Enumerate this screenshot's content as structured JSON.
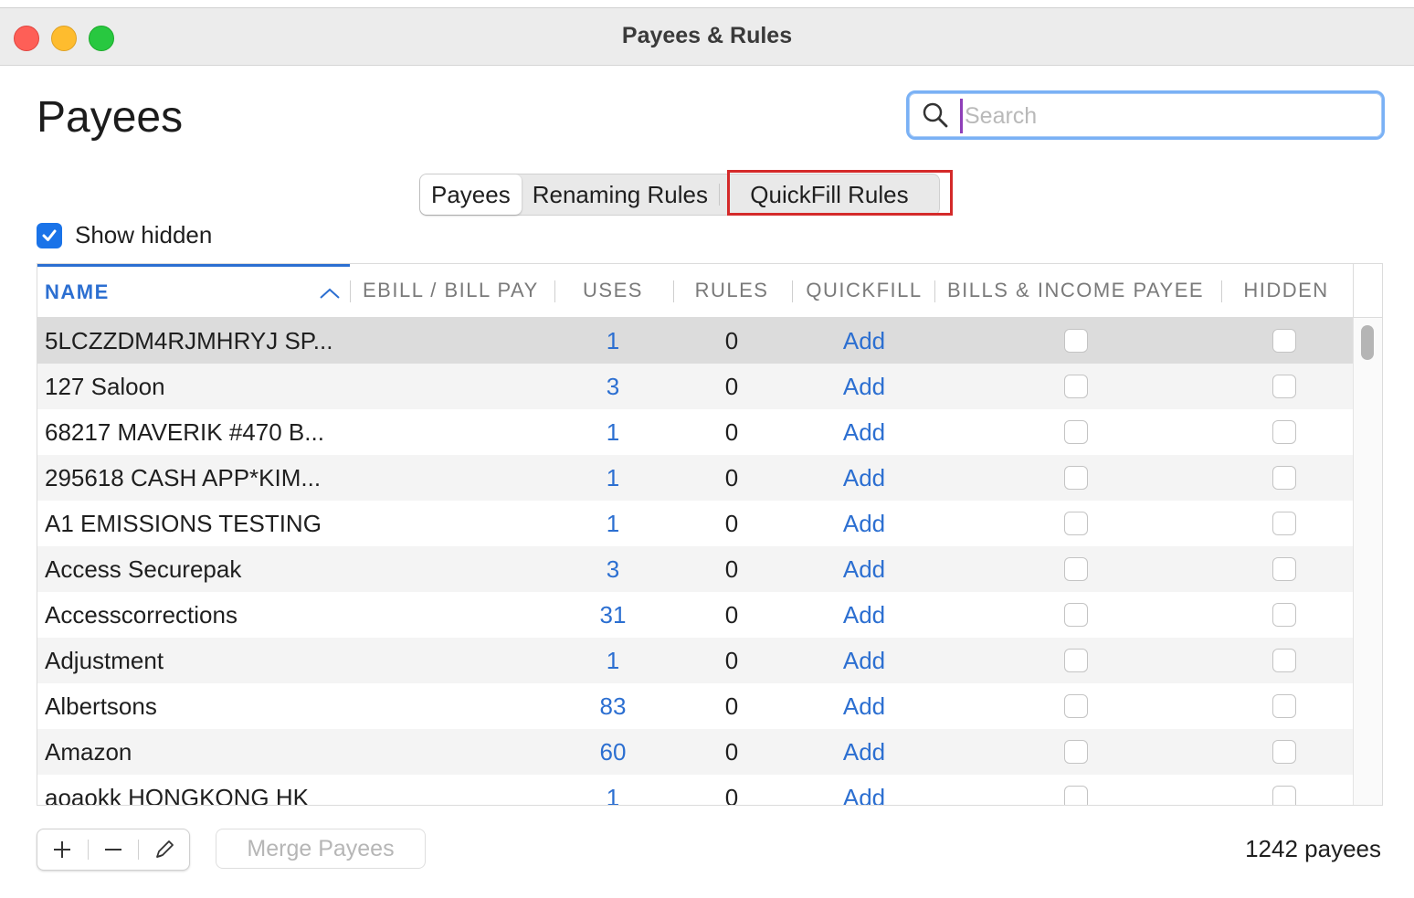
{
  "window": {
    "title": "Payees & Rules"
  },
  "page": {
    "heading": "Payees"
  },
  "search": {
    "placeholder": "Search",
    "value": ""
  },
  "tabs": [
    {
      "label": "Payees",
      "active": true
    },
    {
      "label": "Renaming Rules",
      "active": false
    },
    {
      "label": "QuickFill Rules",
      "active": false,
      "highlighted": true
    }
  ],
  "show_hidden": {
    "label": "Show hidden",
    "checked": true
  },
  "table": {
    "columns": [
      "NAME",
      "EBILL / BILL PAY",
      "USES",
      "RULES",
      "QUICKFILL",
      "BILLS & INCOME PAYEE",
      "HIDDEN"
    ],
    "sorted_column": "NAME",
    "rows": [
      {
        "name": "5LCZZDM4RJMHRYJ SP...",
        "uses": "1",
        "rules": "0",
        "quickfill": "Add",
        "bills_income": false,
        "hidden": false,
        "selected": true
      },
      {
        "name": "127 Saloon",
        "uses": "3",
        "rules": "0",
        "quickfill": "Add",
        "bills_income": false,
        "hidden": false
      },
      {
        "name": "68217 MAVERIK #470 B...",
        "uses": "1",
        "rules": "0",
        "quickfill": "Add",
        "bills_income": false,
        "hidden": false
      },
      {
        "name": "295618 CASH APP*KIM...",
        "uses": "1",
        "rules": "0",
        "quickfill": "Add",
        "bills_income": false,
        "hidden": false
      },
      {
        "name": "A1 EMISSIONS TESTING",
        "uses": "1",
        "rules": "0",
        "quickfill": "Add",
        "bills_income": false,
        "hidden": false
      },
      {
        "name": "Access Securepak",
        "uses": "3",
        "rules": "0",
        "quickfill": "Add",
        "bills_income": false,
        "hidden": false
      },
      {
        "name": "Accesscorrections",
        "uses": "31",
        "rules": "0",
        "quickfill": "Add",
        "bills_income": false,
        "hidden": false
      },
      {
        "name": "Adjustment",
        "uses": "1",
        "rules": "0",
        "quickfill": "Add",
        "bills_income": false,
        "hidden": false
      },
      {
        "name": "Albertsons",
        "uses": "83",
        "rules": "0",
        "quickfill": "Add",
        "bills_income": false,
        "hidden": false
      },
      {
        "name": "Amazon",
        "uses": "60",
        "rules": "0",
        "quickfill": "Add",
        "bills_income": false,
        "hidden": false
      },
      {
        "name": "aoaokk HONGKONG HK",
        "uses": "1",
        "rules": "0",
        "quickfill": "Add",
        "bills_income": false,
        "hidden": false
      }
    ]
  },
  "footer": {
    "add_icon": "plus-icon",
    "remove_icon": "minus-icon",
    "edit_icon": "pencil-icon",
    "merge_label": "Merge Payees",
    "count_label": "1242 payees"
  },
  "colors": {
    "accent": "#2c6fd1",
    "highlight_box": "#d42a2a",
    "search_focus": "#7ab1f5"
  }
}
